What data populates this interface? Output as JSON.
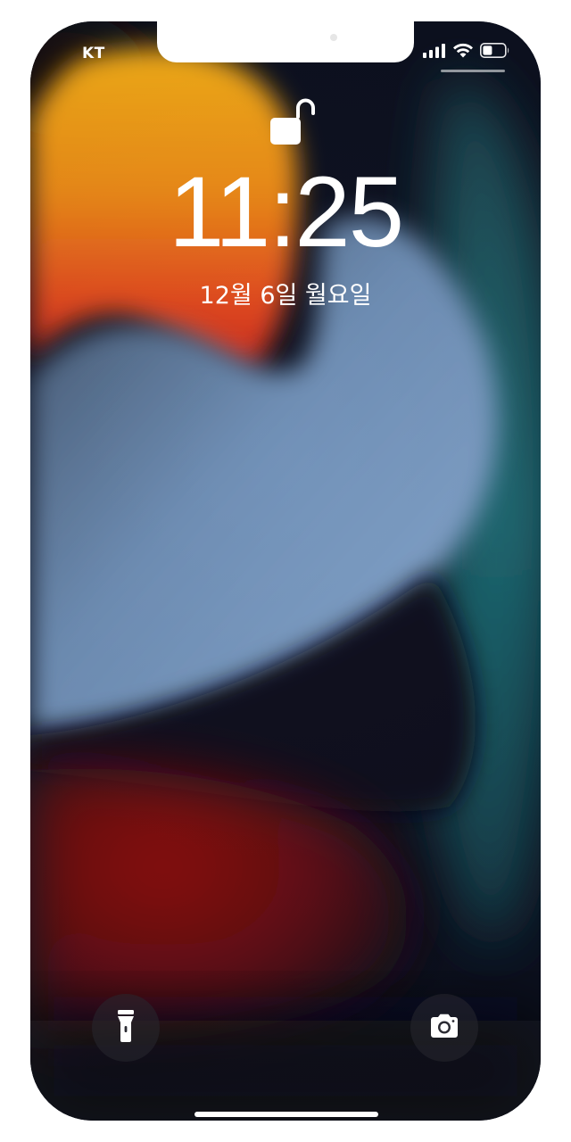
{
  "status_bar": {
    "carrier": "KT",
    "signal_icon": "cellular-signal-icon",
    "wifi_icon": "wifi-icon",
    "battery_icon": "battery-icon"
  },
  "lock_screen": {
    "lock_icon": "unlocked-padlock-icon",
    "time": "11:25",
    "date": "12월 6일 월요일"
  },
  "quick_actions": {
    "flashlight_icon": "flashlight-icon",
    "camera_icon": "camera-icon"
  },
  "colors": {
    "frame": "#ffffff",
    "text": "#ffffff",
    "wallpaper_orange": "#f0a010",
    "wallpaper_red": "#8a0a12",
    "wallpaper_blue_gray": "#7a9cc4",
    "wallpaper_teal": "#1a6a74",
    "wallpaper_dark": "#0b0f1e"
  }
}
